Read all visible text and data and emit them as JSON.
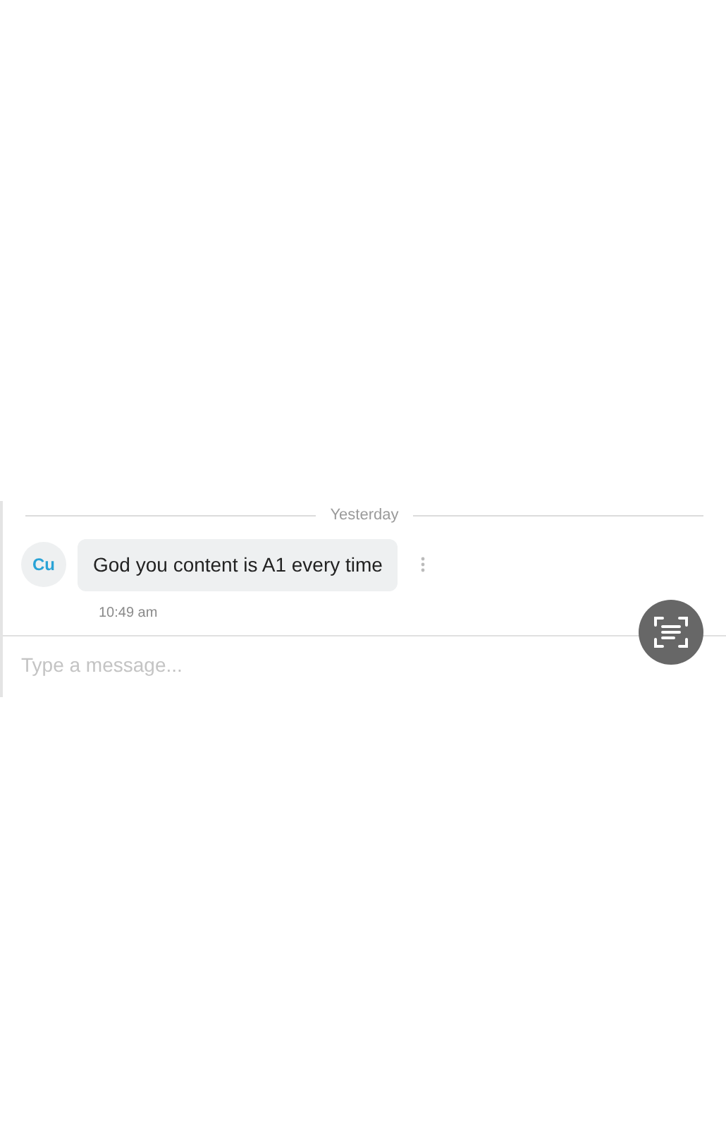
{
  "date_divider": "Yesterday",
  "messages": [
    {
      "avatar": "Cu",
      "text": "God you content is A1 every time",
      "time": "10:49 am"
    }
  ],
  "composer": {
    "placeholder": "Type a message..."
  }
}
